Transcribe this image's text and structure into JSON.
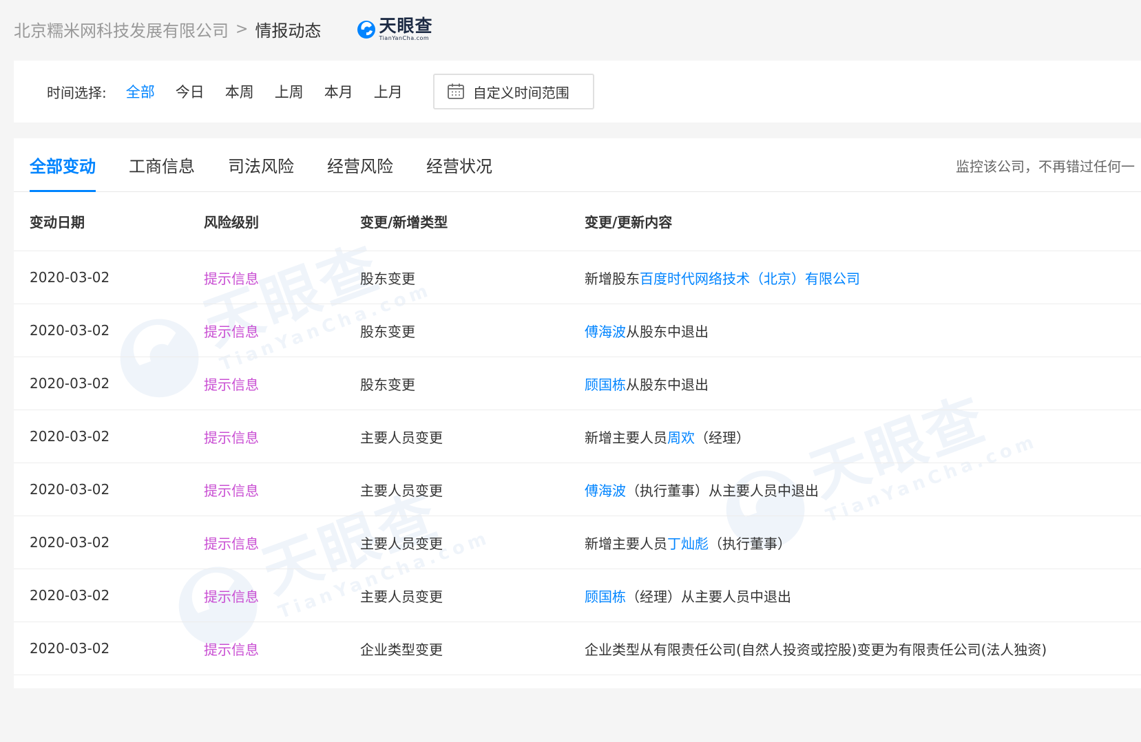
{
  "breadcrumb": {
    "company": "北京糯米网科技发展有限公司",
    "separator": ">",
    "current": "情报动态"
  },
  "brand": {
    "name": "天眼查",
    "sub": "TianYanCha.com",
    "color": "#1d2b44",
    "accent": "#0084ff"
  },
  "filter": {
    "label": "时间选择:",
    "options": [
      "全部",
      "今日",
      "本周",
      "上周",
      "本月",
      "上月"
    ],
    "active_index": 0,
    "custom_range_label": "自定义时间范围",
    "custom_range_icon": "calendar-icon"
  },
  "tabs": {
    "items": [
      "全部变动",
      "工商信息",
      "司法风险",
      "经营风险",
      "经营状况"
    ],
    "active_index": 0,
    "monitor_text": "监控该公司，不再错过任何一"
  },
  "table": {
    "headers": {
      "date": "变动日期",
      "risk": "风险级别",
      "type": "变更/新增类型",
      "content": "变更/更新内容"
    },
    "rows": [
      {
        "date": "2020-03-02",
        "risk": "提示信息",
        "type": "股东变更",
        "content": [
          {
            "text": "新增股东",
            "link": false
          },
          {
            "text": "百度时代网络技术（北京）有限公司",
            "link": true
          }
        ]
      },
      {
        "date": "2020-03-02",
        "risk": "提示信息",
        "type": "股东变更",
        "content": [
          {
            "text": "傅海波",
            "link": true
          },
          {
            "text": "从股东中退出",
            "link": false
          }
        ]
      },
      {
        "date": "2020-03-02",
        "risk": "提示信息",
        "type": "股东变更",
        "content": [
          {
            "text": "顾国栋",
            "link": true
          },
          {
            "text": "从股东中退出",
            "link": false
          }
        ]
      },
      {
        "date": "2020-03-02",
        "risk": "提示信息",
        "type": "主要人员变更",
        "content": [
          {
            "text": "新增主要人员",
            "link": false
          },
          {
            "text": "周欢",
            "link": true
          },
          {
            "text": "（经理）",
            "link": false
          }
        ]
      },
      {
        "date": "2020-03-02",
        "risk": "提示信息",
        "type": "主要人员变更",
        "content": [
          {
            "text": "傅海波",
            "link": true
          },
          {
            "text": "（执行董事）从主要人员中退出",
            "link": false
          }
        ]
      },
      {
        "date": "2020-03-02",
        "risk": "提示信息",
        "type": "主要人员变更",
        "content": [
          {
            "text": "新增主要人员",
            "link": false
          },
          {
            "text": "丁灿彪",
            "link": true
          },
          {
            "text": "（执行董事）",
            "link": false
          }
        ]
      },
      {
        "date": "2020-03-02",
        "risk": "提示信息",
        "type": "主要人员变更",
        "content": [
          {
            "text": "顾国栋",
            "link": true
          },
          {
            "text": "（经理）从主要人员中退出",
            "link": false
          }
        ]
      },
      {
        "date": "2020-03-02",
        "risk": "提示信息",
        "type": "企业类型变更",
        "content": [
          {
            "text": "企业类型从有限责任公司(自然人投资或控股)变更为有限责任公司(法人独资)",
            "link": false
          }
        ]
      }
    ]
  },
  "colors": {
    "accent": "#0084ff",
    "risk_hint": "#c94fd3",
    "text": "#333333",
    "muted": "#999999"
  }
}
